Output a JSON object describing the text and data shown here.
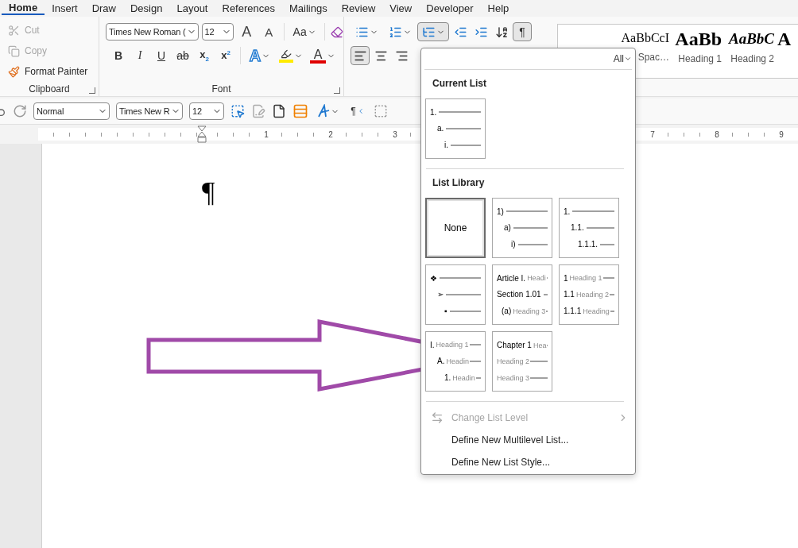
{
  "tabs": [
    {
      "label": "Home",
      "selected": true
    },
    {
      "label": "Insert",
      "selected": false
    },
    {
      "label": "Draw",
      "selected": false
    },
    {
      "label": "Design",
      "selected": false
    },
    {
      "label": "Layout",
      "selected": false
    },
    {
      "label": "References",
      "selected": false
    },
    {
      "label": "Mailings",
      "selected": false
    },
    {
      "label": "Review",
      "selected": false
    },
    {
      "label": "View",
      "selected": false
    },
    {
      "label": "Developer",
      "selected": false
    },
    {
      "label": "Help",
      "selected": false
    }
  ],
  "clipboard": {
    "title": "Clipboard",
    "items": [
      {
        "label": "Cut",
        "kind": "cut",
        "disabled": true
      },
      {
        "label": "Copy",
        "kind": "copy",
        "disabled": true
      },
      {
        "label": "Format Painter",
        "kind": "painter",
        "disabled": false
      }
    ]
  },
  "font": {
    "title": "Font",
    "font_name": "Times New Roman (",
    "font_size": "12",
    "grow": "A",
    "shrink": "A",
    "change_case": "Aa",
    "format_buttons": [
      {
        "label": "B",
        "kind": "bold"
      },
      {
        "label": "I",
        "kind": "italic"
      },
      {
        "label": "U",
        "kind": "underline"
      },
      {
        "label": "ab",
        "kind": "strike"
      },
      {
        "label": "x$_{2}$",
        "kind": "sub"
      },
      {
        "label": "x$^{2}$",
        "kind": "sup"
      }
    ],
    "effects": "A",
    "font_color": "A"
  },
  "paragraph": {
    "pilcrow": "¶",
    "pilcrow_on": true,
    "multilevel_open": true,
    "align": [
      {
        "kind": "left",
        "selected": true
      },
      {
        "kind": "center",
        "selected": false
      },
      {
        "kind": "right",
        "selected": false
      }
    ]
  },
  "styles": [
    {
      "preview": "AaBbCcI",
      "name": "Spac…",
      "kind": "plain"
    },
    {
      "preview": "AaBb",
      "name": "Heading 1",
      "kind": "h1"
    },
    {
      "preview": "AaBbC",
      "name": "Heading 2",
      "kind": "h2"
    },
    {
      "preview": "A",
      "kind": "h1"
    }
  ],
  "quick_toolbar": {
    "style": "Normal",
    "font_name": "Times New R",
    "font_size": "12",
    "pilcrow": "¶"
  },
  "ruler": {
    "numbers": [
      "1",
      "2",
      "3",
      "7",
      "8",
      "9"
    ]
  },
  "document": {
    "pilcrow": "¶"
  },
  "menu": {
    "filter": "All",
    "current_heading": "Current List",
    "current": [
      {
        "kind": "levels",
        "selected": false,
        "indented": true,
        "lines": [
          {
            "marker": "1."
          },
          {
            "marker": "a."
          },
          {
            "marker": "i."
          }
        ]
      }
    ],
    "library_heading": "List Library",
    "library": [
      {
        "kind": "none",
        "label": "None",
        "selected": true
      },
      {
        "kind": "levels",
        "selected": false,
        "indented": true,
        "lines": [
          {
            "marker": "1)"
          },
          {
            "marker": "a)"
          },
          {
            "marker": "i)"
          }
        ]
      },
      {
        "kind": "levels",
        "selected": false,
        "indented": true,
        "lines": [
          {
            "marker": "1."
          },
          {
            "marker": "1.1."
          },
          {
            "marker": "1.1.1."
          }
        ]
      },
      {
        "kind": "levels",
        "selected": false,
        "indented": true,
        "lines": [
          {
            "marker": "❖"
          },
          {
            "marker": "➢"
          },
          {
            "marker": "▪"
          }
        ]
      },
      {
        "kind": "levels",
        "selected": false,
        "indented": false,
        "lines": [
          {
            "marker": "Article I.",
            "text": "Headi"
          },
          {
            "marker": "Section 1.01"
          },
          {
            "marker": "(a)",
            "text": "Heading 3"
          }
        ]
      },
      {
        "kind": "levels",
        "selected": false,
        "indented": false,
        "lines": [
          {
            "marker": "1",
            "text": "Heading 1"
          },
          {
            "marker": "1.1",
            "text": "Heading 2"
          },
          {
            "marker": "1.1.1",
            "text": "Heading"
          }
        ]
      },
      {
        "kind": "levels",
        "selected": false,
        "indented": true,
        "lines": [
          {
            "marker": "I.",
            "text": "Heading 1"
          },
          {
            "marker": "A.",
            "text": "Headin"
          },
          {
            "marker": "1.",
            "text": "Headin"
          }
        ]
      },
      {
        "kind": "levels",
        "selected": false,
        "indented": false,
        "lines": [
          {
            "marker": "Chapter 1",
            "text": "Hea"
          },
          {
            "text": "Heading 2"
          },
          {
            "text": "Heading 3"
          }
        ]
      }
    ],
    "actions": [
      {
        "label": "Change List Level",
        "kind": "level",
        "disabled": true,
        "submenu": true
      },
      {
        "label": "Define New Multilevel List...",
        "kind": "plain",
        "disabled": false,
        "submenu": false
      },
      {
        "label": "Define New List Style...",
        "kind": "plain",
        "disabled": false,
        "submenu": false
      }
    ]
  }
}
